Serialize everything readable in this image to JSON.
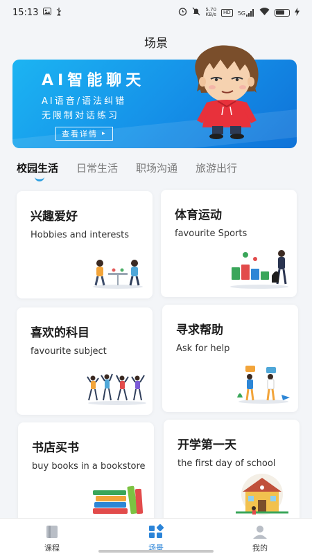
{
  "status_bar": {
    "time": "15:13",
    "net_speed_value": "5.70",
    "net_speed_unit": "KB/s",
    "hd_badge": "HD",
    "signal_label": "5G"
  },
  "header": {
    "title": "场景"
  },
  "banner": {
    "title": "AI智能聊天",
    "line1": "AI语音/语法纠错",
    "line2": "无限制对话练习",
    "button_label": "查看详情",
    "button_arrow": "▸"
  },
  "tabs": [
    {
      "label": "校园生活",
      "active": true
    },
    {
      "label": "日常生活",
      "active": false
    },
    {
      "label": "职场沟通",
      "active": false
    },
    {
      "label": "旅游出行",
      "active": false
    }
  ],
  "scenes": [
    {
      "title": "兴趣爱好",
      "subtitle": "Hobbies and interests",
      "art": "people-chatting-illustration"
    },
    {
      "title": "体育运动",
      "subtitle": "favourite Sports",
      "art": "recycling-bins-illustration"
    },
    {
      "title": "喜欢的科目",
      "subtitle": "favourite subject",
      "art": "dancing-people-illustration"
    },
    {
      "title": "寻求帮助",
      "subtitle": "Ask for help",
      "art": "two-people-talking-illustration"
    },
    {
      "title": "书店买书",
      "subtitle": "buy books in a bookstore",
      "art": "stack-of-books-illustration"
    },
    {
      "title": "开学第一天",
      "subtitle": "the first day of school",
      "art": "school-building-illustration"
    }
  ],
  "bottom_nav": [
    {
      "label": "课程",
      "icon": "book-icon",
      "active": false
    },
    {
      "label": "场景",
      "icon": "scene-grid-icon",
      "active": true
    },
    {
      "label": "我的",
      "icon": "profile-icon",
      "active": false
    }
  ],
  "colors": {
    "accent": "#2b84d8",
    "banner_start": "#1cb4f2",
    "banner_end": "#0f72d8",
    "mascot_hoodie": "#e8313b"
  }
}
